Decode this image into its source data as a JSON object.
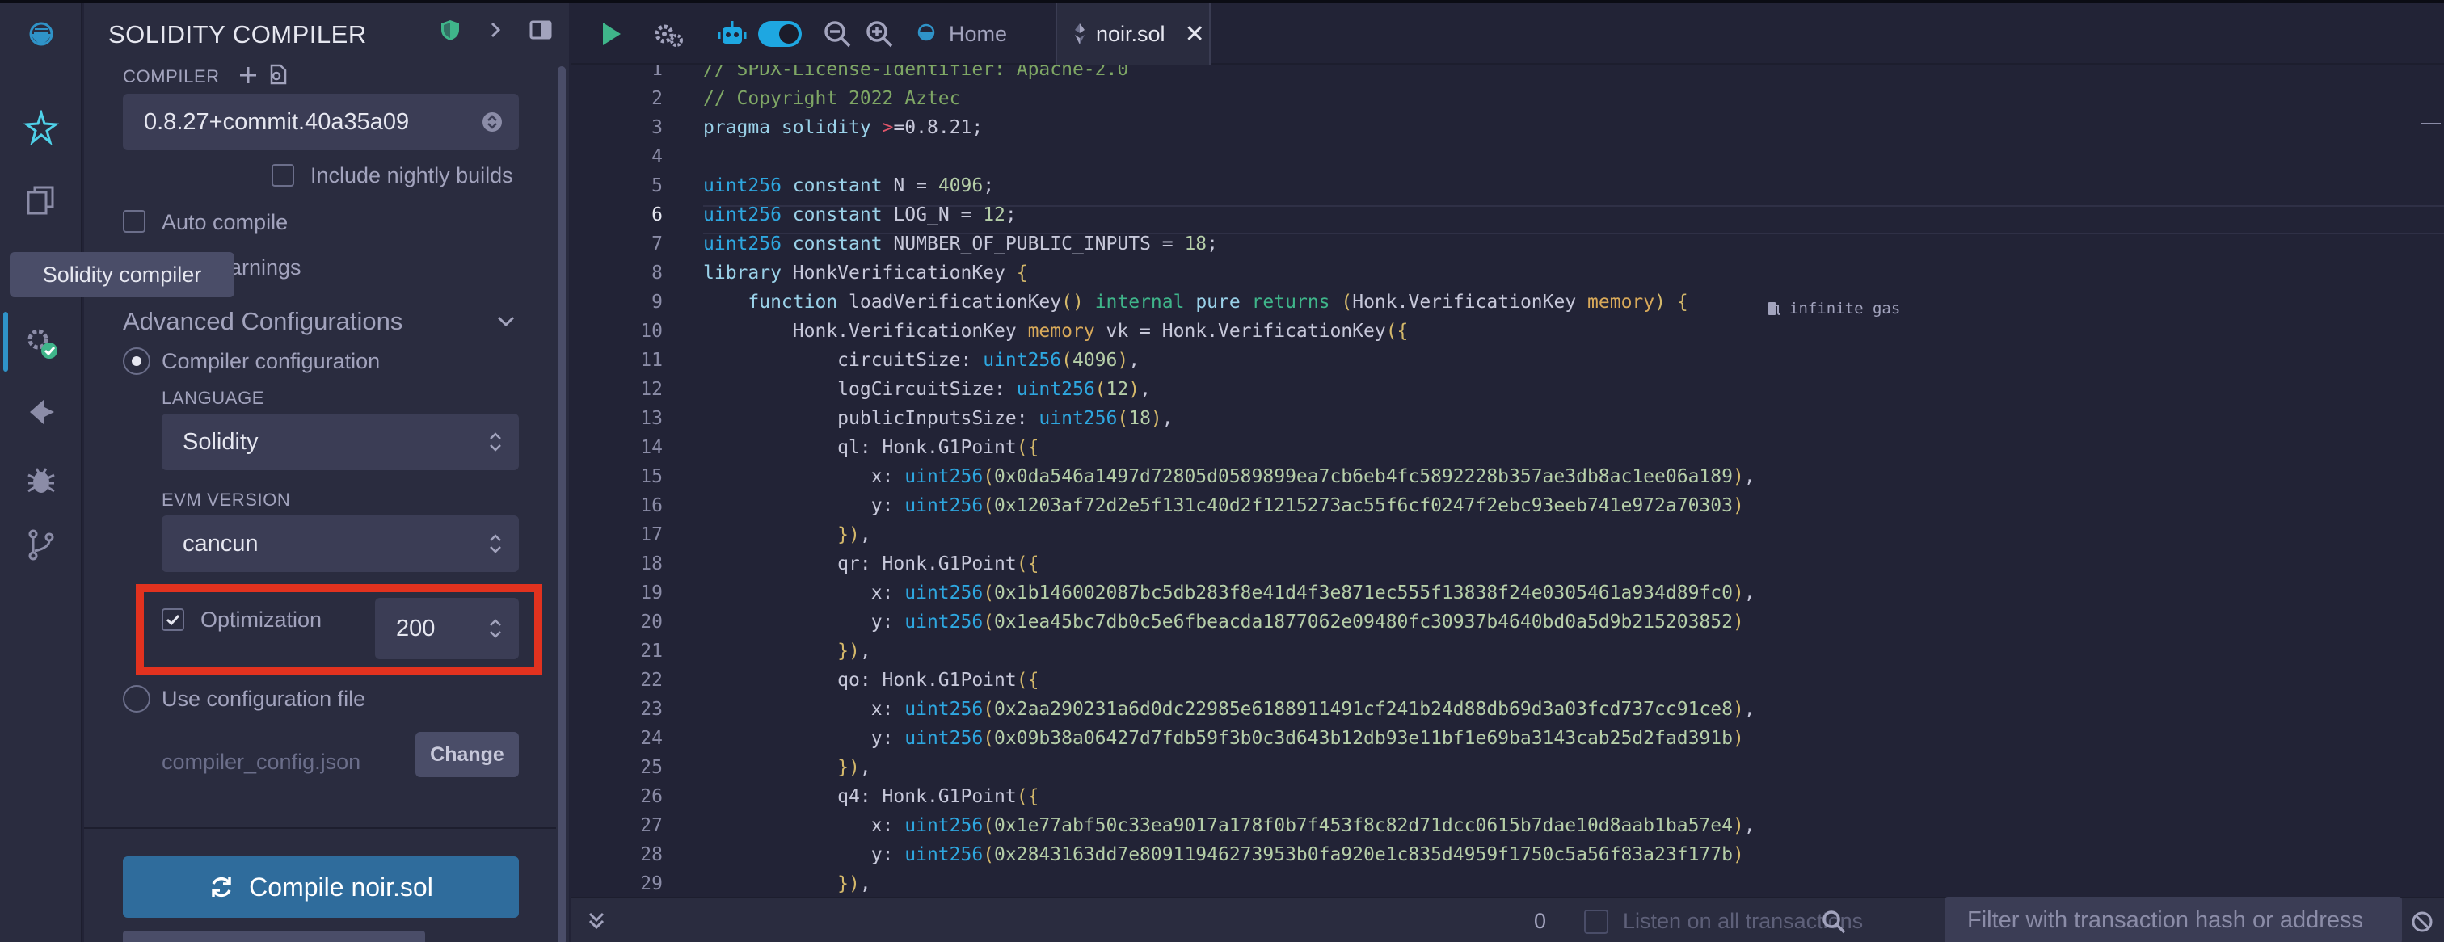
{
  "sidebar_tooltip": "Solidity compiler",
  "panel": {
    "title": "SOLIDITY COMPILER",
    "compiler_label": "COMPILER",
    "compiler_version": "0.8.27+commit.40a35a09",
    "nightly_label": "Include nightly builds",
    "auto_compile_label": "Auto compile",
    "warnings_fragment": "arnings",
    "advanced_title": "Advanced Configurations",
    "compiler_config_label": "Compiler configuration",
    "language_label": "LANGUAGE",
    "language_value": "Solidity",
    "evm_label": "EVM VERSION",
    "evm_value": "cancun",
    "optimization_label": "Optimization",
    "optimization_runs": "200",
    "use_config_label": "Use configuration file",
    "config_file": "compiler_config.json",
    "change_label": "Change",
    "compile_button": "Compile noir.sol"
  },
  "tabs": {
    "home": "Home",
    "active": "noir.sol"
  },
  "editor": {
    "current_line": 6,
    "gas_annotation": "infinite gas",
    "line_numbers": [
      "1",
      "2",
      "3",
      "4",
      "5",
      "6",
      "7",
      "8",
      "9",
      "10",
      "11",
      "12",
      "13",
      "14",
      "15",
      "16",
      "17",
      "18",
      "19",
      "20",
      "21",
      "22",
      "23",
      "24",
      "25",
      "26",
      "27",
      "28",
      "29"
    ]
  },
  "terminal": {
    "count": "0",
    "listen_label": "Listen on all transactions",
    "filter_placeholder": "Filter with transaction hash or address"
  },
  "colors": {
    "accent": "#2f6c9c",
    "highlight_box": "#e2321f",
    "toggle": "#1ea7e1"
  }
}
